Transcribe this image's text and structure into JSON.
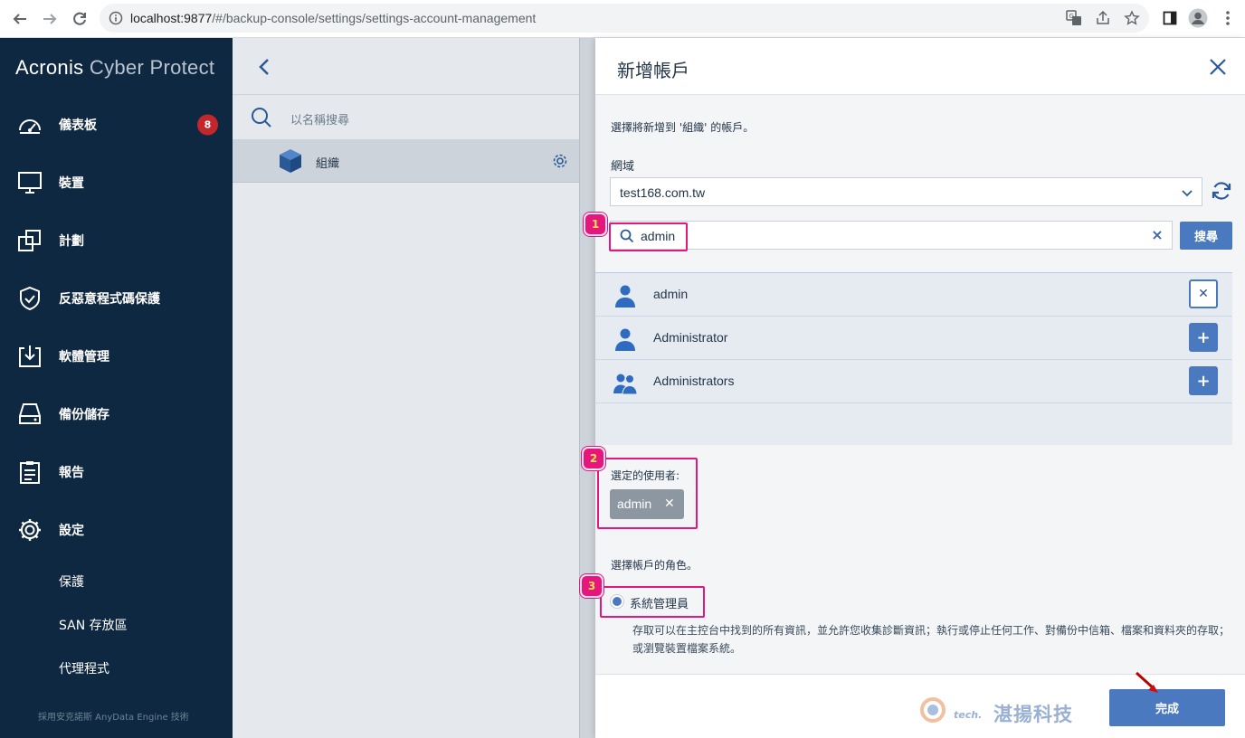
{
  "browser": {
    "url_host": "localhost:9877",
    "url_path": "/#/backup-console/settings/settings-account-management"
  },
  "sidebar": {
    "logo_brand": "Acronis",
    "logo_product": "Cyber Protect",
    "items": [
      {
        "label": "儀表板",
        "icon": "dashboard-icon",
        "badge": "8"
      },
      {
        "label": "裝置",
        "icon": "monitor-icon"
      },
      {
        "label": "計劃",
        "icon": "plans-icon"
      },
      {
        "label": "反惡意程式碼保護",
        "icon": "shield-icon"
      },
      {
        "label": "軟體管理",
        "icon": "software-download-icon"
      },
      {
        "label": "備份儲存",
        "icon": "storage-icon"
      },
      {
        "label": "報告",
        "icon": "clipboard-icon"
      },
      {
        "label": "設定",
        "icon": "gear-icon"
      }
    ],
    "sub_items": [
      "保護",
      "SAN 存放區",
      "代理程式"
    ],
    "footer": "採用安克諾斯 AnyData Engine 技術"
  },
  "middle": {
    "search_placeholder": "以名稱搜尋",
    "org_label": "組織"
  },
  "dialog": {
    "title": "新增帳戶",
    "intro": "選擇將新增到 '組織' 的帳戶。",
    "domain_label": "網域",
    "domain_value": "test168.com.tw",
    "search_value": "admin",
    "search_button": "搜尋",
    "results": [
      {
        "name": "admin",
        "icon": "user-icon",
        "action": "remove"
      },
      {
        "name": "Administrator",
        "icon": "user-icon",
        "action": "add"
      },
      {
        "name": "Administrators",
        "icon": "users-group-icon",
        "action": "add"
      }
    ],
    "selected_label": "選定的使用者:",
    "selected_chip": "admin",
    "role_label": "選擇帳戶的角色。",
    "role_option": "系統管理員",
    "role_description": "存取可以在主控台中找到的所有資訊，並允許您收集診斷資訊；執行或停止任何工作、對備份中信箱、檔案和資料夾的存取；或瀏覽裝置檔案系統。",
    "done_button": "完成",
    "watermark": "湛揚科技",
    "watermark_small": "tech."
  },
  "annotations": [
    "1",
    "2",
    "3"
  ],
  "colors": {
    "sidebar_bg": "#0f2841",
    "accent": "#4a79c0",
    "annotation": "#e6177c",
    "badge": "#c3272b"
  }
}
